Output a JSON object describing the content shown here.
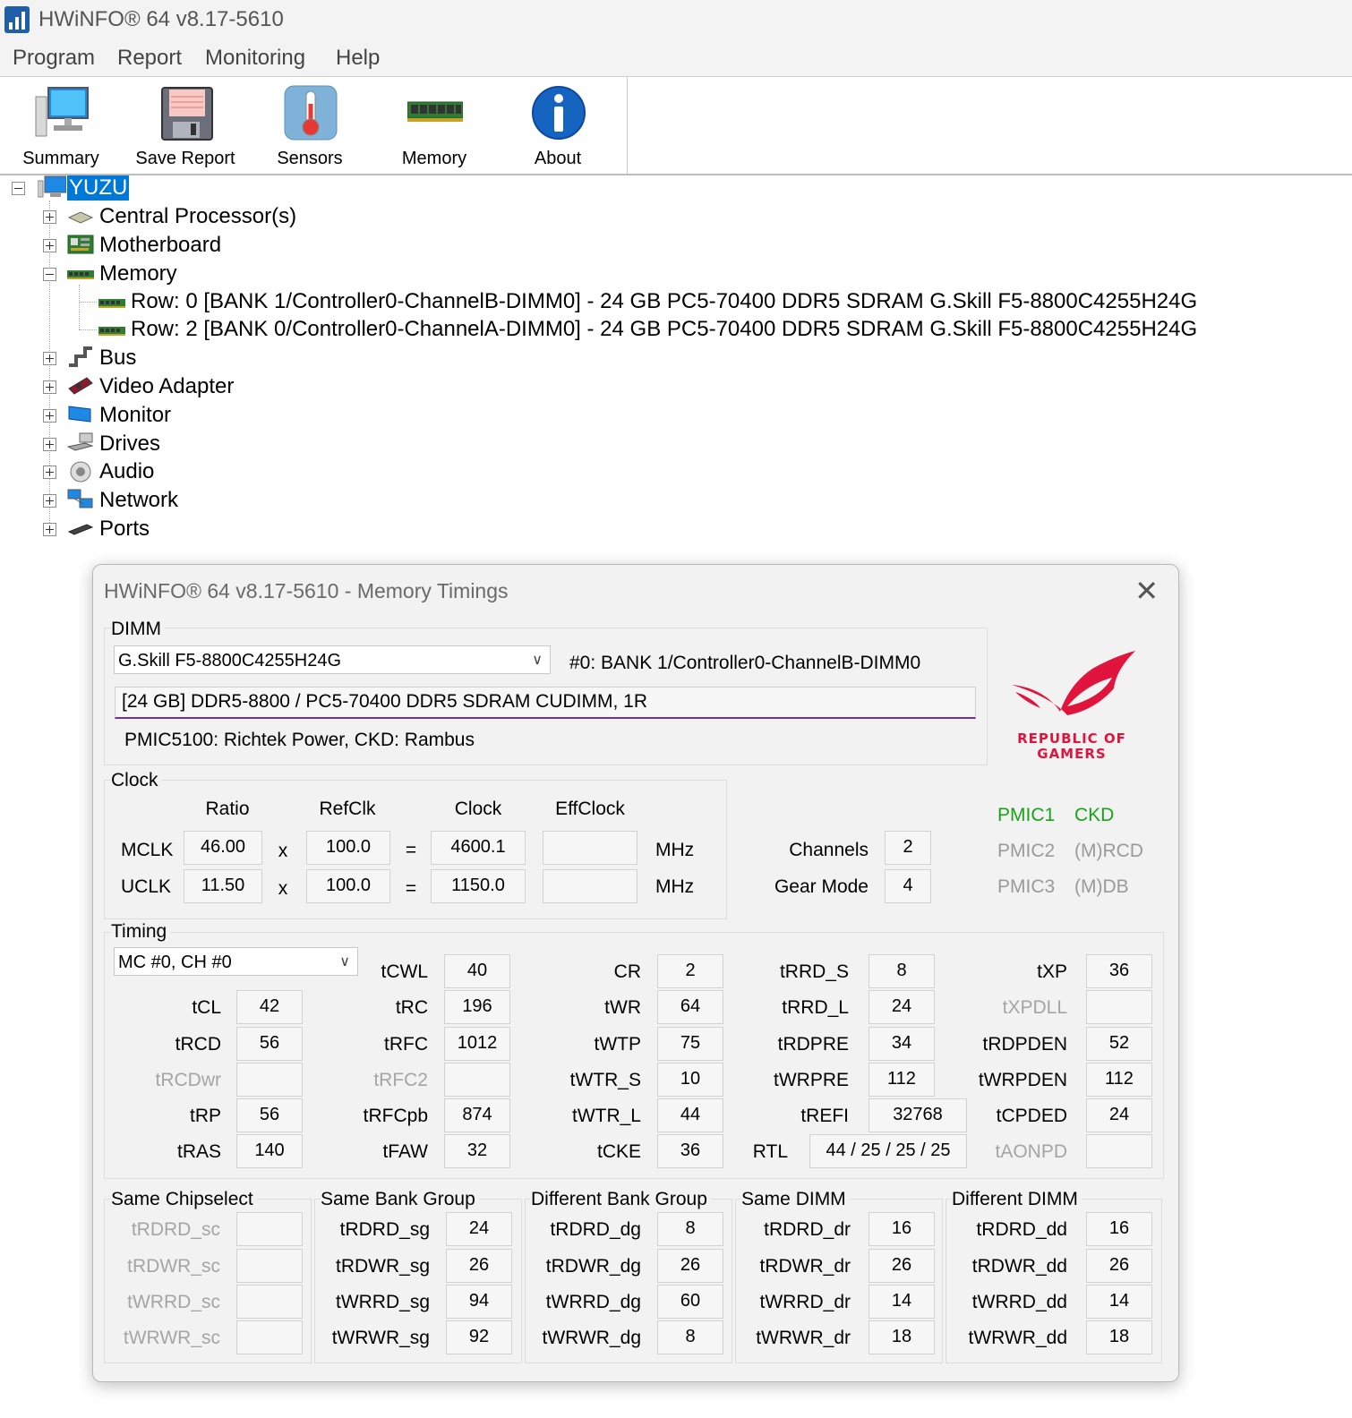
{
  "window": {
    "title": "HWiNFO® 64 v8.17-5610"
  },
  "menu": [
    "Program",
    "Report",
    "Monitoring",
    "Help"
  ],
  "toolbar": [
    {
      "label": "Summary",
      "icon": "computer-icon"
    },
    {
      "label": "Save Report",
      "icon": "floppy-disk-icon"
    },
    {
      "label": "Sensors",
      "icon": "thermometer-icon"
    },
    {
      "label": "Memory",
      "icon": "ram-module-icon"
    },
    {
      "label": "About",
      "icon": "info-icon"
    }
  ],
  "tree": {
    "root": "YUZU",
    "nodes": [
      {
        "label": "Central Processor(s)",
        "icon": "cpu-icon",
        "expanded": false
      },
      {
        "label": "Motherboard",
        "icon": "motherboard-icon",
        "expanded": false
      },
      {
        "label": "Memory",
        "icon": "ram-module-icon",
        "expanded": true,
        "children": [
          "Row: 0 [BANK 1/Controller0-ChannelB-DIMM0] - 24 GB PC5-70400 DDR5 SDRAM G.Skill F5-8800C4255H24G",
          "Row: 2 [BANK 0/Controller0-ChannelA-DIMM0] - 24 GB PC5-70400 DDR5 SDRAM G.Skill F5-8800C4255H24G"
        ]
      },
      {
        "label": "Bus",
        "icon": "bus-icon",
        "expanded": false
      },
      {
        "label": "Video Adapter",
        "icon": "gpu-icon",
        "expanded": false
      },
      {
        "label": "Monitor",
        "icon": "monitor-icon",
        "expanded": false
      },
      {
        "label": "Drives",
        "icon": "drive-icon",
        "expanded": false
      },
      {
        "label": "Audio",
        "icon": "speaker-icon",
        "expanded": false
      },
      {
        "label": "Network",
        "icon": "network-icon",
        "expanded": false
      },
      {
        "label": "Ports",
        "icon": "port-icon",
        "expanded": false
      }
    ]
  },
  "dialog": {
    "title": "HWiNFO® 64 v8.17-5610 - Memory Timings",
    "dimm": {
      "group_label": "DIMM",
      "selected": "G.Skill F5-8800C4255H24G",
      "slot": "#0: BANK 1/Controller0-ChannelB-DIMM0",
      "spec": "[24 GB] DDR5-8800 / PC5-70400 DDR5 SDRAM CUDIMM, 1R",
      "pmic": "PMIC5100: Richtek Power, CKD: Rambus"
    },
    "logo": {
      "line1": "REPUBLIC OF",
      "line2": "GAMERS",
      "color": "#e0143c"
    },
    "clock": {
      "group_label": "Clock",
      "headers": [
        "Ratio",
        "RefClk",
        "Clock",
        "EffClock"
      ],
      "rows": [
        {
          "name": "MCLK",
          "ratio": "46.00",
          "refclk": "100.0",
          "clock": "4600.1",
          "effclock": "",
          "unit": "MHz"
        },
        {
          "name": "UCLK",
          "ratio": "11.50",
          "refclk": "100.0",
          "clock": "1150.0",
          "effclock": "",
          "unit": "MHz"
        }
      ],
      "mult": "x",
      "eq": "=",
      "channels_label": "Channels",
      "channels": "2",
      "gear_label": "Gear Mode",
      "gear": "4"
    },
    "status": [
      {
        "label": "PMIC1",
        "active": true
      },
      {
        "label": "CKD",
        "active": true
      },
      {
        "label": "PMIC2",
        "active": false
      },
      {
        "label": "(M)RCD",
        "active": false
      },
      {
        "label": "PMIC3",
        "active": false
      },
      {
        "label": "(M)DB",
        "active": false
      }
    ],
    "timing": {
      "group_label": "Timing",
      "mc_select": "MC #0, CH #0",
      "columns": [
        [
          {
            "name": "tCL",
            "value": "42"
          },
          {
            "name": "tRCD",
            "value": "56"
          },
          {
            "name": "tRCDwr",
            "value": "",
            "disabled": true
          },
          {
            "name": "tRP",
            "value": "56"
          },
          {
            "name": "tRAS",
            "value": "140"
          }
        ],
        [
          {
            "name": "tCWL",
            "value": "40"
          },
          {
            "name": "tRC",
            "value": "196"
          },
          {
            "name": "tRFC",
            "value": "1012"
          },
          {
            "name": "tRFC2",
            "value": "",
            "disabled": true
          },
          {
            "name": "tRFCpb",
            "value": "874"
          },
          {
            "name": "tFAW",
            "value": "32"
          }
        ],
        [
          {
            "name": "CR",
            "value": "2"
          },
          {
            "name": "tWR",
            "value": "64"
          },
          {
            "name": "tWTP",
            "value": "75"
          },
          {
            "name": "tWTR_S",
            "value": "10"
          },
          {
            "name": "tWTR_L",
            "value": "44"
          },
          {
            "name": "tCKE",
            "value": "36"
          }
        ],
        [
          {
            "name": "tRRD_S",
            "value": "8"
          },
          {
            "name": "tRRD_L",
            "value": "24"
          },
          {
            "name": "tRDPRE",
            "value": "34"
          },
          {
            "name": "tWRPRE",
            "value": "112"
          },
          {
            "name": "tREFI",
            "value": "32768"
          },
          {
            "name": "RTL",
            "value": "44 / 25 / 25 / 25"
          }
        ],
        [
          {
            "name": "tXP",
            "value": "36"
          },
          {
            "name": "tXPDLL",
            "value": "",
            "disabled": true
          },
          {
            "name": "tRDPDEN",
            "value": "52"
          },
          {
            "name": "tWRPDEN",
            "value": "112"
          },
          {
            "name": "tCPDED",
            "value": "24"
          },
          {
            "name": "tAONPD",
            "value": "",
            "disabled": true
          }
        ]
      ]
    },
    "turnaround": [
      {
        "label": "Same Chipselect",
        "rows": [
          {
            "name": "tRDRD_sc",
            "value": "",
            "disabled": true
          },
          {
            "name": "tRDWR_sc",
            "value": "",
            "disabled": true
          },
          {
            "name": "tWRRD_sc",
            "value": "",
            "disabled": true
          },
          {
            "name": "tWRWR_sc",
            "value": "",
            "disabled": true
          }
        ]
      },
      {
        "label": "Same Bank Group",
        "rows": [
          {
            "name": "tRDRD_sg",
            "value": "24"
          },
          {
            "name": "tRDWR_sg",
            "value": "26"
          },
          {
            "name": "tWRRD_sg",
            "value": "94"
          },
          {
            "name": "tWRWR_sg",
            "value": "92"
          }
        ]
      },
      {
        "label": "Different Bank Group",
        "rows": [
          {
            "name": "tRDRD_dg",
            "value": "8"
          },
          {
            "name": "tRDWR_dg",
            "value": "26"
          },
          {
            "name": "tWRRD_dg",
            "value": "60"
          },
          {
            "name": "tWRWR_dg",
            "value": "8"
          }
        ]
      },
      {
        "label": "Same DIMM",
        "rows": [
          {
            "name": "tRDRD_dr",
            "value": "16"
          },
          {
            "name": "tRDWR_dr",
            "value": "26"
          },
          {
            "name": "tWRRD_dr",
            "value": "14"
          },
          {
            "name": "tWRWR_dr",
            "value": "18"
          }
        ]
      },
      {
        "label": "Different DIMM",
        "rows": [
          {
            "name": "tRDRD_dd",
            "value": "16"
          },
          {
            "name": "tRDWR_dd",
            "value": "26"
          },
          {
            "name": "tWRRD_dd",
            "value": "14"
          },
          {
            "name": "tWRWR_dd",
            "value": "18"
          }
        ]
      }
    ]
  }
}
